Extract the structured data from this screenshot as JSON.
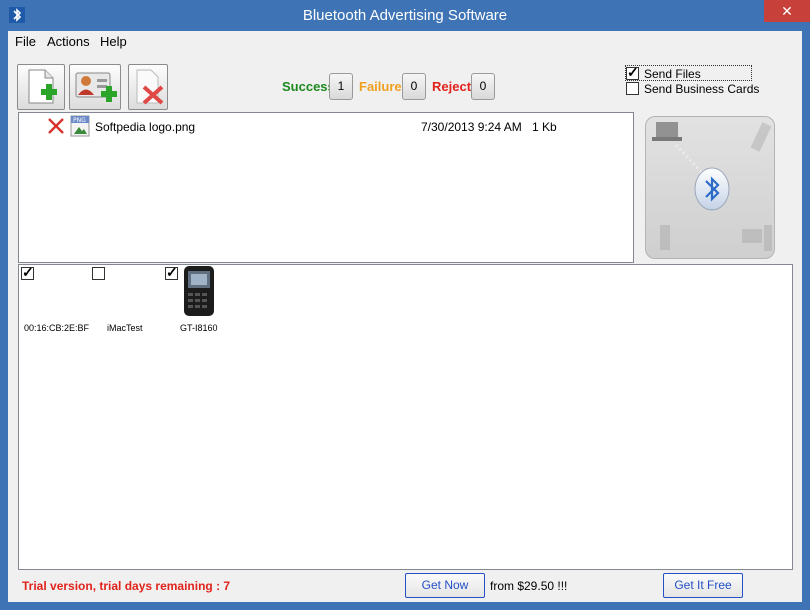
{
  "window": {
    "title": "Bluetooth Advertising Software",
    "close_glyph": "✕"
  },
  "menu": [
    "File",
    "Actions",
    "Help"
  ],
  "toolbar": {
    "add_file_icon": "add-file-icon",
    "add_contact_icon": "add-contact-icon",
    "remove_file_icon": "remove-file-icon"
  },
  "counters": {
    "success_label": "Success",
    "success_value": "1",
    "failure_label": "Failure",
    "failure_value": "0",
    "reject_label": "Reject",
    "reject_value": "0",
    "colors": {
      "success": "#1e8a1e",
      "failure": "#f0a020",
      "reject": "#e1231d"
    }
  },
  "options": {
    "send_files": {
      "label": "Send Files",
      "checked": true
    },
    "send_business_cards": {
      "label": "Send Business Cards",
      "checked": false
    }
  },
  "files": [
    {
      "name": "Softpedia logo.png",
      "date": "7/30/2013 9:24 AM",
      "size": "1 Kb"
    }
  ],
  "devices": [
    {
      "name": "00:16:CB:2E:BF",
      "checked": true,
      "icon": ""
    },
    {
      "name": "iMacTest",
      "checked": false,
      "icon": ""
    },
    {
      "name": "GT-I8160",
      "checked": true,
      "icon": "phone-icon"
    }
  ],
  "status": {
    "trial_text": "Trial version, trial days remaining : 7",
    "get_now_label": "Get Now",
    "price_text": "from $29.50 !!!",
    "get_free_label": "Get It Free"
  }
}
